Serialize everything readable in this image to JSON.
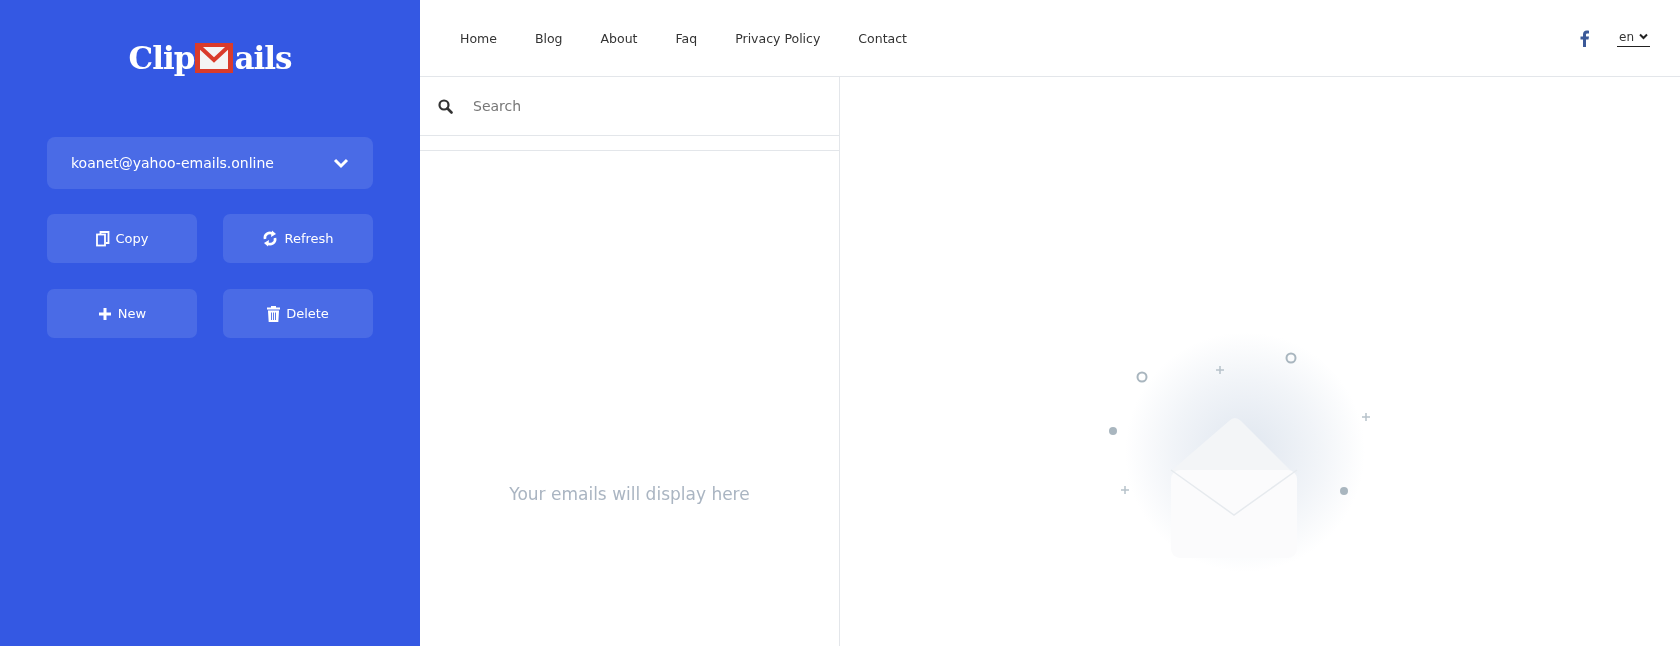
{
  "sidebar": {
    "logo": {
      "before": "Clip",
      "after": "ails"
    },
    "email_select": {
      "value": "koanet@yahoo-emails.online"
    },
    "buttons": [
      {
        "label": "Copy",
        "kind": "copy"
      },
      {
        "label": "Refresh",
        "kind": "refresh"
      },
      {
        "label": "New",
        "kind": "new"
      },
      {
        "label": "Delete",
        "kind": "delete"
      }
    ]
  },
  "nav": {
    "links": [
      "Home",
      "Blog",
      "About",
      "Faq",
      "Privacy Policy",
      "Contact"
    ],
    "language": "en"
  },
  "inbox": {
    "search": {
      "placeholder": "Search"
    },
    "empty_message": "Your emails will display here"
  }
}
